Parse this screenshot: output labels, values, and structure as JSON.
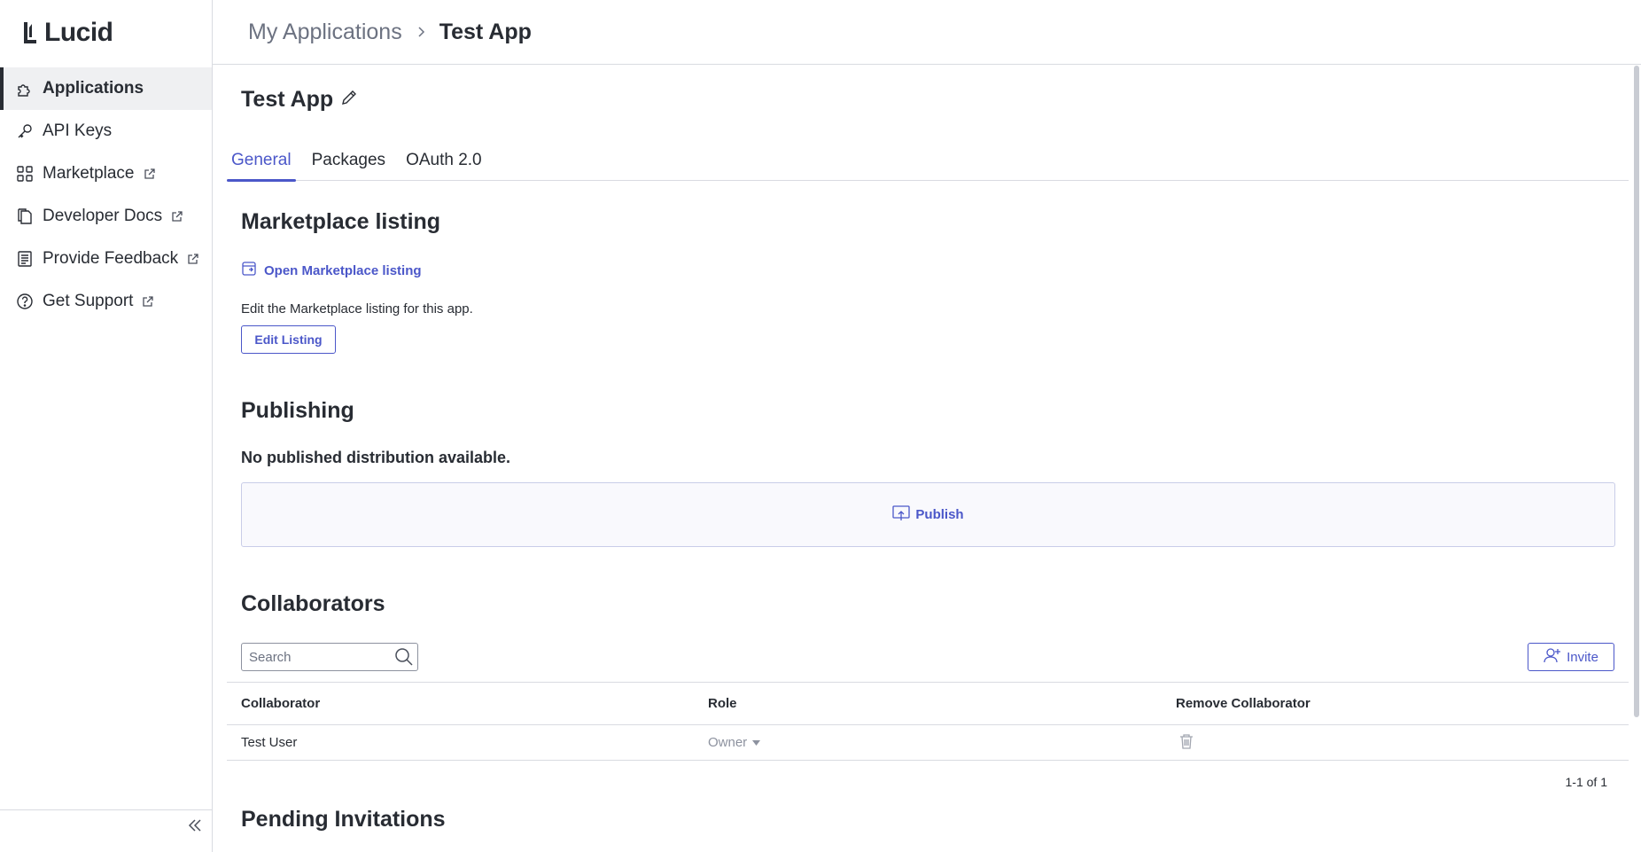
{
  "brand": {
    "name": "Lucid"
  },
  "sidebar": {
    "items": [
      {
        "label": "Applications",
        "icon": "puzzle-icon",
        "active": true,
        "external": false
      },
      {
        "label": "API Keys",
        "icon": "key-icon",
        "active": false,
        "external": false
      },
      {
        "label": "Marketplace",
        "icon": "grid-icon",
        "active": false,
        "external": true
      },
      {
        "label": "Developer Docs",
        "icon": "docs-icon",
        "active": false,
        "external": true
      },
      {
        "label": "Provide Feedback",
        "icon": "feedback-icon",
        "active": false,
        "external": true
      },
      {
        "label": "Get Support",
        "icon": "help-icon",
        "active": false,
        "external": true
      }
    ]
  },
  "breadcrumb": {
    "parent": "My Applications",
    "current": "Test App"
  },
  "app": {
    "title": "Test App"
  },
  "tabs": [
    {
      "label": "General",
      "active": true
    },
    {
      "label": "Packages",
      "active": false
    },
    {
      "label": "OAuth 2.0",
      "active": false
    }
  ],
  "marketplace": {
    "heading": "Marketplace listing",
    "open_link": "Open Marketplace listing",
    "description": "Edit the Marketplace listing for this app.",
    "edit_button": "Edit Listing"
  },
  "publishing": {
    "heading": "Publishing",
    "status": "No published distribution available.",
    "publish_button": "Publish"
  },
  "collaborators": {
    "heading": "Collaborators",
    "search_placeholder": "Search",
    "invite_button": "Invite",
    "columns": [
      "Collaborator",
      "Role",
      "Remove Collaborator"
    ],
    "rows": [
      {
        "name": "Test User",
        "role": "Owner"
      }
    ],
    "pager": "1-1 of 1"
  },
  "pending": {
    "heading": "Pending Invitations"
  },
  "colors": {
    "accent": "#4b57c9",
    "text": "#282c33",
    "muted": "#6c7281",
    "border": "#d9dbe1"
  }
}
